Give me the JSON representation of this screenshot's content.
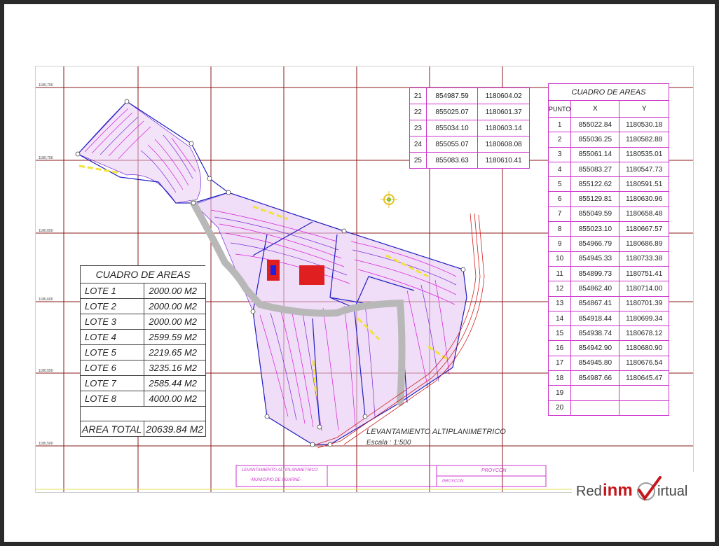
{
  "coord_top": {
    "rows": [
      {
        "n": "21",
        "x": "854987.59",
        "y": "1180604.02"
      },
      {
        "n": "22",
        "x": "855025.07",
        "y": "1180601.37"
      },
      {
        "n": "23",
        "x": "855034.10",
        "y": "1180603.14"
      },
      {
        "n": "24",
        "x": "855055.07",
        "y": "1180608.08"
      },
      {
        "n": "25",
        "x": "855083.63",
        "y": "1180610.41"
      }
    ]
  },
  "coord_right": {
    "title": "CUADRO DE AREAS",
    "h_punto": "PUNTO",
    "h_x": "X",
    "h_y": "Y",
    "rows": [
      {
        "n": "1",
        "x": "855022.84",
        "y": "1180530.18"
      },
      {
        "n": "2",
        "x": "855036.25",
        "y": "1180582.88"
      },
      {
        "n": "3",
        "x": "855061.14",
        "y": "1180535.01"
      },
      {
        "n": "4",
        "x": "855083.27",
        "y": "1180547.73"
      },
      {
        "n": "5",
        "x": "855122.62",
        "y": "1180591.51"
      },
      {
        "n": "6",
        "x": "855129.81",
        "y": "1180630.96"
      },
      {
        "n": "7",
        "x": "855049.59",
        "y": "1180658.48"
      },
      {
        "n": "8",
        "x": "855023.10",
        "y": "1180667.57"
      },
      {
        "n": "9",
        "x": "854966.79",
        "y": "1180686.89"
      },
      {
        "n": "10",
        "x": "854945.33",
        "y": "1180733.38"
      },
      {
        "n": "11",
        "x": "854899.73",
        "y": "1180751.41"
      },
      {
        "n": "12",
        "x": "854862.40",
        "y": "1180714.00"
      },
      {
        "n": "13",
        "x": "854867.41",
        "y": "1180701.39"
      },
      {
        "n": "14",
        "x": "854918.44",
        "y": "1180699.34"
      },
      {
        "n": "15",
        "x": "854938.74",
        "y": "1180678.12"
      },
      {
        "n": "16",
        "x": "854942.90",
        "y": "1180680.90"
      },
      {
        "n": "17",
        "x": "854945.80",
        "y": "1180676.54"
      },
      {
        "n": "18",
        "x": "854987.66",
        "y": "1180645.47"
      },
      {
        "n": "19",
        "x": "",
        "y": ""
      },
      {
        "n": "20",
        "x": "",
        "y": ""
      }
    ]
  },
  "lots": {
    "title": "CUADRO DE AREAS",
    "rows": [
      {
        "lote": "LOTE 1",
        "area": "2000.00 M2"
      },
      {
        "lote": "LOTE 2",
        "area": "2000.00 M2"
      },
      {
        "lote": "LOTE 3",
        "area": "2000.00 M2"
      },
      {
        "lote": "LOTE 4",
        "area": "2599.59 M2"
      },
      {
        "lote": "LOTE 5",
        "area": "2219.65 M2"
      },
      {
        "lote": "LOTE 6",
        "area": "3235.16 M2"
      },
      {
        "lote": "LOTE 7",
        "area": "2585.44 M2"
      },
      {
        "lote": "LOTE 8",
        "area": "4000.00 M2"
      }
    ],
    "total_label": "AREA TOTAL",
    "total_value": "20639.84 M2"
  },
  "drawing": {
    "caption": "LEVANTAMIENTO ALTIPLANIMETRICO",
    "scale": "Escala : 1:500"
  },
  "title_block": {
    "project_line1": "LEVANTAMIENTO ALTIPLANIMETRICO",
    "project_line2": "-MUNICIPIO DE GUARNE-",
    "owner": "PROYCON",
    "sub": "PROYCON"
  },
  "logo": {
    "part1": "Red",
    "part2": "inm",
    "part3": "irtual"
  },
  "colors": {
    "contour_magenta": "#d81bd8",
    "contour_purple": "#7a2bd6",
    "lot_boundary": "#2020c0",
    "grid": "#8a1a1a",
    "road": "#b8b8b8",
    "brand_red": "#c4161c"
  }
}
